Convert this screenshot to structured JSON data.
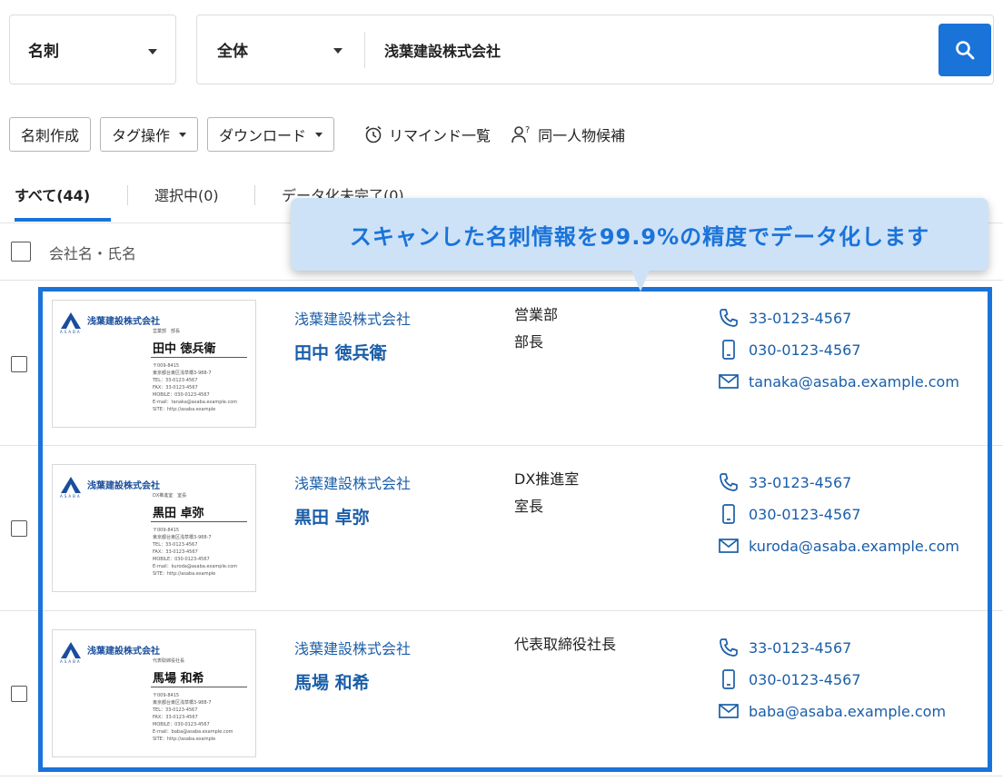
{
  "search": {
    "type_label": "名刺",
    "scope_label": "全体",
    "query": "浅葉建設株式会社"
  },
  "toolbar": {
    "create_label": "名刺作成",
    "tag_label": "タグ操作",
    "download_label": "ダウンロード",
    "reminder_label": "リマインド一覧",
    "duplicate_label": "同一人物候補"
  },
  "tabs": {
    "all": "すべて(44)",
    "selected": "選択中(0)",
    "incomplete": "データ化未完了(0)"
  },
  "list_header": {
    "label": "会社名・氏名"
  },
  "tooltip": {
    "text": "スキャンした名刺情報を99.9%の精度でデータ化します"
  },
  "rows": [
    {
      "company": "浅葉建設株式会社",
      "name": "田中 徳兵衛",
      "dept": "営業部",
      "title": "部長",
      "phone": "33-0123-4567",
      "mobile": "030-0123-4567",
      "email": "tanaka@asaba.example.com",
      "card": {
        "brand": "ASABA",
        "company": "浅葉建設株式会社",
        "dept": "営業部　部長",
        "name": "田中 徳兵衛",
        "postal": "〒009-8415",
        "address": "東京都台東区浅草橋3-988-7",
        "tel": "TEL：33-0123-4567",
        "fax": "FAX：33-0123-4567",
        "mobile": "MOBILE：030-0123-4567",
        "email": "E-mail：tanaka@asaba.example.com",
        "site": "SITE：http://asaba.example"
      }
    },
    {
      "company": "浅葉建設株式会社",
      "name": "黒田 卓弥",
      "dept": "DX推進室",
      "title": "室長",
      "phone": "33-0123-4567",
      "mobile": "030-0123-4567",
      "email": "kuroda@asaba.example.com",
      "card": {
        "brand": "ASABA",
        "company": "浅葉建設株式会社",
        "dept": "DX推進室　室長",
        "name": "黒田 卓弥",
        "postal": "〒009-8415",
        "address": "東京都台東区浅草橋3-988-7",
        "tel": "TEL：33-0123-4567",
        "fax": "FAX：33-0123-4567",
        "mobile": "MOBILE：030-0123-4567",
        "email": "E-mail：kuroda@asaba.example.com",
        "site": "SITE：http://asaba.example"
      }
    },
    {
      "company": "浅葉建設株式会社",
      "name": "馬場 和希",
      "dept": "代表取締役社長",
      "title": "",
      "phone": "33-0123-4567",
      "mobile": "030-0123-4567",
      "email": "baba@asaba.example.com",
      "card": {
        "brand": "ASABA",
        "company": "浅葉建設株式会社",
        "dept": "代表取締役社長",
        "name": "馬場 和希",
        "postal": "〒009-8415",
        "address": "東京都台東区浅草橋3-988-7",
        "tel": "TEL：33-0123-4567",
        "fax": "FAX：33-0123-4567",
        "mobile": "MOBILE：030-0123-4567",
        "email": "E-mail：baba@asaba.example.com",
        "site": "SITE：http://asaba.example"
      }
    }
  ],
  "colors": {
    "accent": "#1a73d9",
    "link": "#1a5ea8",
    "tooltip_bg": "#cde2f7"
  }
}
